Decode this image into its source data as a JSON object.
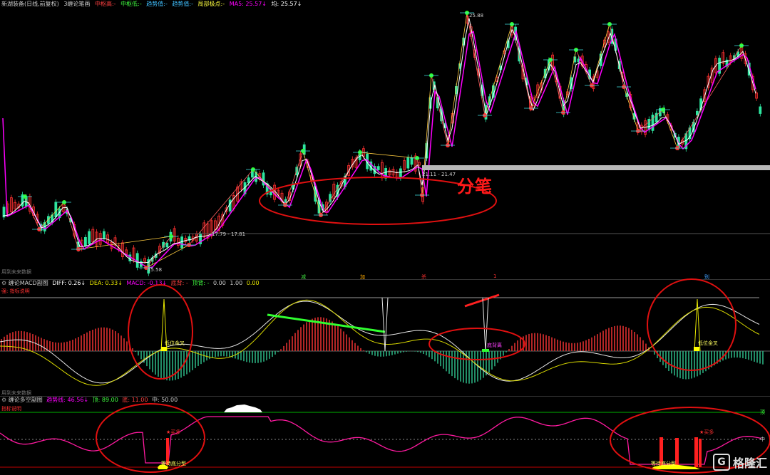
{
  "colors": {
    "background": "#000000",
    "up": "#ff3030",
    "down": "#2ee6a0",
    "ma": "#ff00ff",
    "white_line": "#ffffff",
    "yellow_line": "#e8e800",
    "red_annotation": "#e01010",
    "green_hline": "#00c000"
  },
  "top_legend": {
    "name": "新湖装备(日线,前复权)",
    "indicator": "3缠论笔画",
    "item1": "中枢高:-",
    "item2": "中枢低:-",
    "item3": "趋势值:-",
    "item4": "趋势值:-",
    "item5": "局部极点:-",
    "ma": "MA5: 25.57↓",
    "last": "均: 25.57↓"
  },
  "price_labels": {
    "high": "25.88",
    "low": "15.58",
    "range1": "21.11 - 21.47",
    "range2": "17.79 - 17.81"
  },
  "annotation_main": "分笔",
  "small_markers": [
    "减",
    "加",
    "杀",
    "1",
    "别"
  ],
  "macd_header": {
    "future": "用到未来数据",
    "title": "缠论MACD副图",
    "diff": "DIFF: 0.26↓",
    "dea": "DEA: 0.33↓",
    "macd": "MACD: -0.13↓",
    "item4": "底背: -",
    "item5": "顶背: -",
    "item6": "0.00",
    "item7": "1.00",
    "item8": "0.00",
    "sub": "强: 指标说明"
  },
  "macd_labels": {
    "left": "低位金叉",
    "right": "低位金叉",
    "mid": "底背离"
  },
  "longshort_header": {
    "future": "用到未来数据",
    "title": "缠论多空副图",
    "v1": "趋势线: 46.56↓",
    "v2": "顶: 89.00",
    "v3": "底: 11.00",
    "v4": "中: 50.00",
    "sub": "指标说明"
  },
  "longshort_labels": {
    "left_buy": "★买多",
    "left_bottom": "等待底分型",
    "right_buy": "★买多",
    "right_bottom": "等待底分型",
    "axis_top": "顶",
    "axis_mid": "中"
  },
  "watermark": {
    "icon": "G",
    "text": "格隆汇"
  }
}
